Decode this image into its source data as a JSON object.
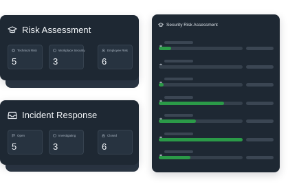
{
  "risk_assessment": {
    "title": "Risk Assessment",
    "icon": "graduation-cap-icon",
    "stats": [
      {
        "label": "Technical Risk",
        "value": "5",
        "icon": "chip-icon"
      },
      {
        "label": "Workplace Security",
        "value": "3",
        "icon": "shield-icon"
      },
      {
        "label": "Employee Risk",
        "value": "6",
        "icon": "user-icon"
      }
    ]
  },
  "incident_response": {
    "title": "Incident Response",
    "icon": "inbox-icon",
    "stats": [
      {
        "label": "Open",
        "value": "5",
        "icon": "flag-icon"
      },
      {
        "label": "Investigating",
        "value": "3",
        "icon": "search-icon"
      },
      {
        "label": "Closed",
        "value": "6",
        "icon": "lock-icon"
      }
    ]
  },
  "security_risk_assessment": {
    "title": "Security Risk Assessment",
    "icon": "graduation-cap-icon",
    "rows": [
      {
        "icon": "fingerprint-icon",
        "progress": 0.15
      },
      {
        "icon": "fingerprint-icon",
        "progress": 0.0
      },
      {
        "icon": "fingerprint-icon",
        "progress": 0.06
      },
      {
        "icon": "fingerprint-icon",
        "progress": 0.78
      },
      {
        "icon": "fingerprint-icon",
        "progress": 0.44
      },
      {
        "icon": "fingerprint-icon",
        "progress": 1.0
      },
      {
        "icon": "fingerprint-icon",
        "progress": 0.38
      }
    ]
  },
  "colors": {
    "card_bg": "#1e2833",
    "stat_bg": "#273340",
    "accent_green": "#2b9a48",
    "track": "#35404c"
  }
}
